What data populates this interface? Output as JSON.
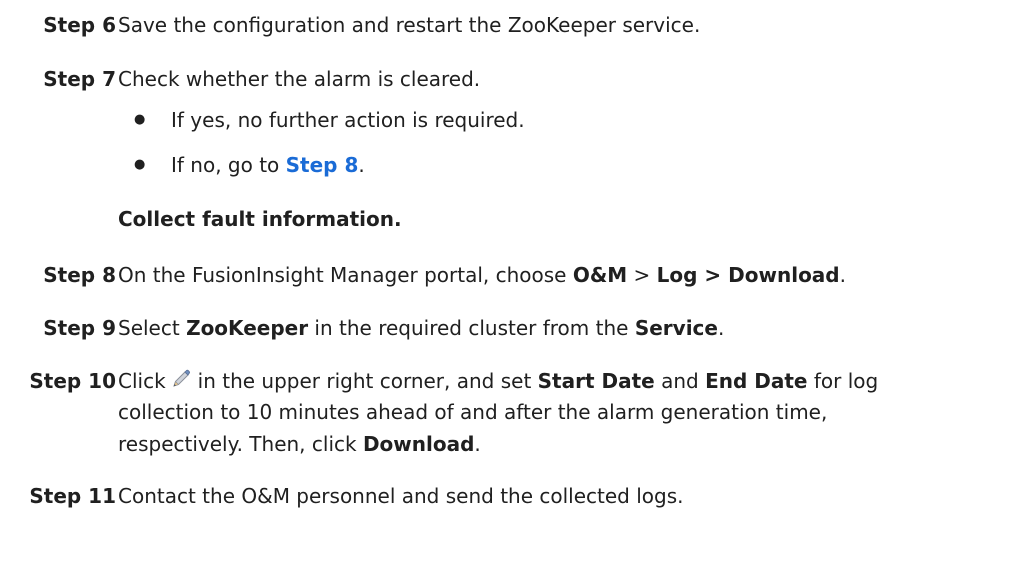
{
  "steps": {
    "s6": {
      "label": "Step 6",
      "text": "Save the configuration and restart the ZooKeeper service."
    },
    "s7": {
      "label": "Step 7",
      "text": "Check whether the alarm is cleared.",
      "bullets": {
        "yes": "If yes, no further action is required.",
        "no_prefix": "If no, go to ",
        "no_link": "Step 8",
        "no_suffix": "."
      }
    },
    "section_title": "Collect fault information.",
    "s8": {
      "label": "Step 8",
      "pre": "On the FusionInsight Manager portal, choose ",
      "b1": "O&M",
      "sep": " > ",
      "b2": "Log > Download",
      "post": "."
    },
    "s9": {
      "label": "Step 9",
      "pre": "Select ",
      "b1": "ZooKeeper",
      "mid": " in the required cluster from the ",
      "b2": "Service",
      "post": "."
    },
    "s10": {
      "label": "Step 10",
      "click": "Click",
      "line1_mid": "in the upper right corner, and set ",
      "b_start": "Start Date",
      "and": " and ",
      "b_end": "End Date",
      "line1_tail": " for log",
      "line2": "collection to 10 minutes ahead of and after the alarm generation time,",
      "line3_pre": "respectively. Then, click ",
      "b_download": "Download",
      "line3_post": "."
    },
    "s11": {
      "label": "Step 11",
      "text": "Contact the O&M personnel and send the collected logs."
    }
  },
  "icons": {
    "edit": "pencil-edit-icon"
  },
  "colors": {
    "link": "#1a6bd6",
    "text": "#202020"
  }
}
